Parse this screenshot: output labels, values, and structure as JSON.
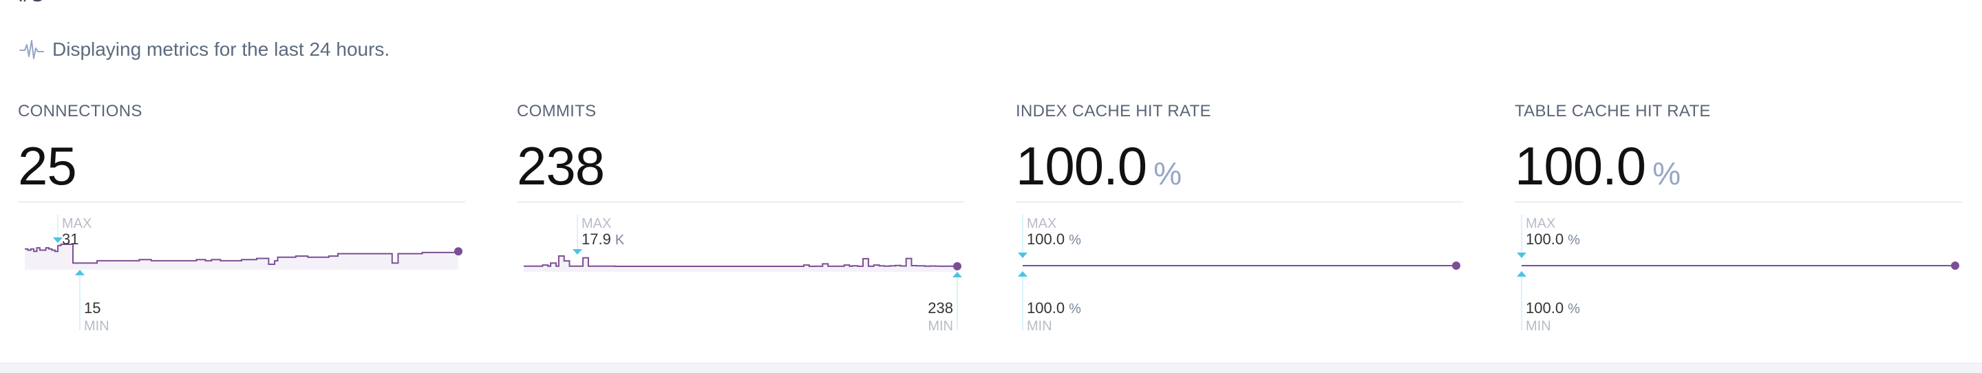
{
  "page": {
    "top_value": "I/O",
    "info_icon": "pulse-icon",
    "info_text": "Displaying metrics for the last 24 hours."
  },
  "colors": {
    "series": "#7b4f94",
    "marker": "#4cc3e6",
    "fill": "#f4f2f8"
  },
  "panels": [
    {
      "title": "CONNECTIONS",
      "value": "25",
      "unit": "",
      "max": {
        "tag": "MAX",
        "value": "31",
        "unit": ""
      },
      "min": {
        "tag": "MIN",
        "value": "15",
        "unit": ""
      },
      "chart_data": {
        "type": "line",
        "series": [
          {
            "values": [
              27,
              26,
              27,
              25,
              28,
              26,
              26,
              28,
              27,
              26,
              25,
              30,
              31,
              31,
              31,
              31,
              15,
              15,
              15,
              15,
              15,
              15,
              15,
              15,
              17,
              17,
              17,
              17,
              17,
              17,
              17,
              17,
              17,
              17,
              17,
              17,
              17,
              17,
              18,
              18,
              18,
              18,
              17,
              17,
              17,
              17,
              17,
              17,
              17,
              17,
              17,
              17,
              17,
              17,
              17,
              17,
              17,
              18,
              18,
              18,
              17,
              17,
              18,
              18,
              18,
              17,
              17,
              17,
              17,
              17,
              17,
              17,
              18,
              18,
              18,
              18,
              18,
              19,
              19,
              19,
              19,
              14,
              14,
              17,
              20,
              20,
              20,
              20,
              20,
              20,
              21,
              21,
              21,
              21,
              20,
              20,
              20,
              20,
              20,
              20,
              20,
              21,
              21,
              21,
              23,
              23,
              23,
              23,
              23,
              23,
              23,
              23,
              23,
              23,
              23,
              23,
              23,
              23,
              23,
              23,
              23,
              23,
              15,
              15,
              23,
              23,
              23,
              23,
              23,
              23,
              23,
              23,
              24,
              24,
              24,
              24,
              24,
              24,
              24,
              24,
              24,
              24,
              24,
              25,
              25
            ]
          }
        ]
      }
    },
    {
      "title": "COMMITS",
      "value": "238",
      "unit": "",
      "max": {
        "tag": "MAX",
        "value": "17.9",
        "unit": "K"
      },
      "min": {
        "tag": "MIN",
        "value": "238",
        "unit": ""
      },
      "chart_data": {
        "type": "line",
        "series": [
          {
            "values": [
              0.4,
              0.4,
              0.4,
              0.6,
              0.6,
              0.4,
              0.4,
              2.5,
              2.5,
              0.4,
              5.8,
              5.8,
              0.4,
              17.9,
              17.9,
              9.5,
              9.5,
              0.4,
              0.4,
              0.4,
              0.4,
              0.4,
              14.8,
              14.8,
              0.4,
              0.4,
              0.4,
              0.4,
              0.4,
              0.4,
              0.4,
              0.4,
              0.4,
              0.4,
              0.2,
              0.2,
              0.2,
              0.2,
              0.2,
              0.2,
              0.2,
              0.2,
              0.2,
              0.2,
              0.2,
              0.2,
              0.2,
              0.2,
              0.2,
              0.2,
              0.2,
              0.2,
              0.2,
              0.2,
              0.2,
              0.2,
              0.2,
              0.2,
              0.2,
              0.2,
              0.2,
              0.2,
              0.2,
              0.2,
              0.2,
              0.2,
              0.2,
              0.2,
              0.2,
              0.2,
              0.2,
              0.2,
              0.2,
              0.2,
              0.2,
              0.2,
              0.2,
              0.2,
              0.2,
              0.2,
              0.2,
              0.2,
              0.2,
              0.2,
              0.2,
              0.2,
              0.2,
              0.2,
              0.2,
              0.2,
              0.2,
              0.2,
              0.2,
              0.2,
              0.2,
              0.2,
              0.2,
              0.2,
              0.2,
              0.2,
              0.2,
              0.2,
              0.2,
              0.2,
              2.4,
              2.4,
              0.2,
              0.2,
              0.3,
              0.3,
              0.3,
              4.5,
              4.5,
              0.3,
              0.3,
              0.3,
              0.3,
              0.3,
              0.3,
              2.4,
              2.4,
              0.3,
              1.2,
              1.2,
              0.3,
              0.3,
              13.3,
              13.3,
              0.3,
              0.3,
              2.5,
              2.5,
              1.0,
              1.0,
              0.6,
              0.6,
              1.0,
              1.0,
              1.6,
              1.6,
              0.8,
              0.8,
              13.6,
              13.6,
              1.4,
              1.4,
              1.1,
              1.1,
              1.1,
              0.6,
              0.6,
              0.8,
              0.8,
              0.6,
              0.6,
              0.3,
              0.3,
              0.5,
              0.5,
              0.3,
              0.3,
              0.3
            ]
          }
        ]
      }
    },
    {
      "title": "INDEX CACHE HIT RATE",
      "value": "100.0",
      "unit": "%",
      "max": {
        "tag": "MAX",
        "value": "100.0",
        "unit": "%"
      },
      "min": {
        "tag": "MIN",
        "value": "100.0",
        "unit": "%"
      },
      "chart_data": {
        "type": "line",
        "ylim": [
          99.9,
          100.1
        ],
        "series": [
          {
            "values": [
              100.0,
              100.0,
              100.0,
              100.0,
              100.0,
              100.0,
              100.0,
              100.0,
              100.0,
              100.0
            ]
          }
        ]
      }
    },
    {
      "title": "TABLE CACHE HIT RATE",
      "value": "100.0",
      "unit": "%",
      "max": {
        "tag": "MAX",
        "value": "100.0",
        "unit": "%"
      },
      "min": {
        "tag": "MIN",
        "value": "100.0",
        "unit": "%"
      },
      "chart_data": {
        "type": "line",
        "ylim": [
          99.9,
          100.1
        ],
        "series": [
          {
            "values": [
              100.0,
              100.0,
              100.0,
              100.0,
              100.0,
              100.0,
              100.0,
              100.0,
              100.0,
              100.0
            ]
          }
        ]
      }
    }
  ]
}
